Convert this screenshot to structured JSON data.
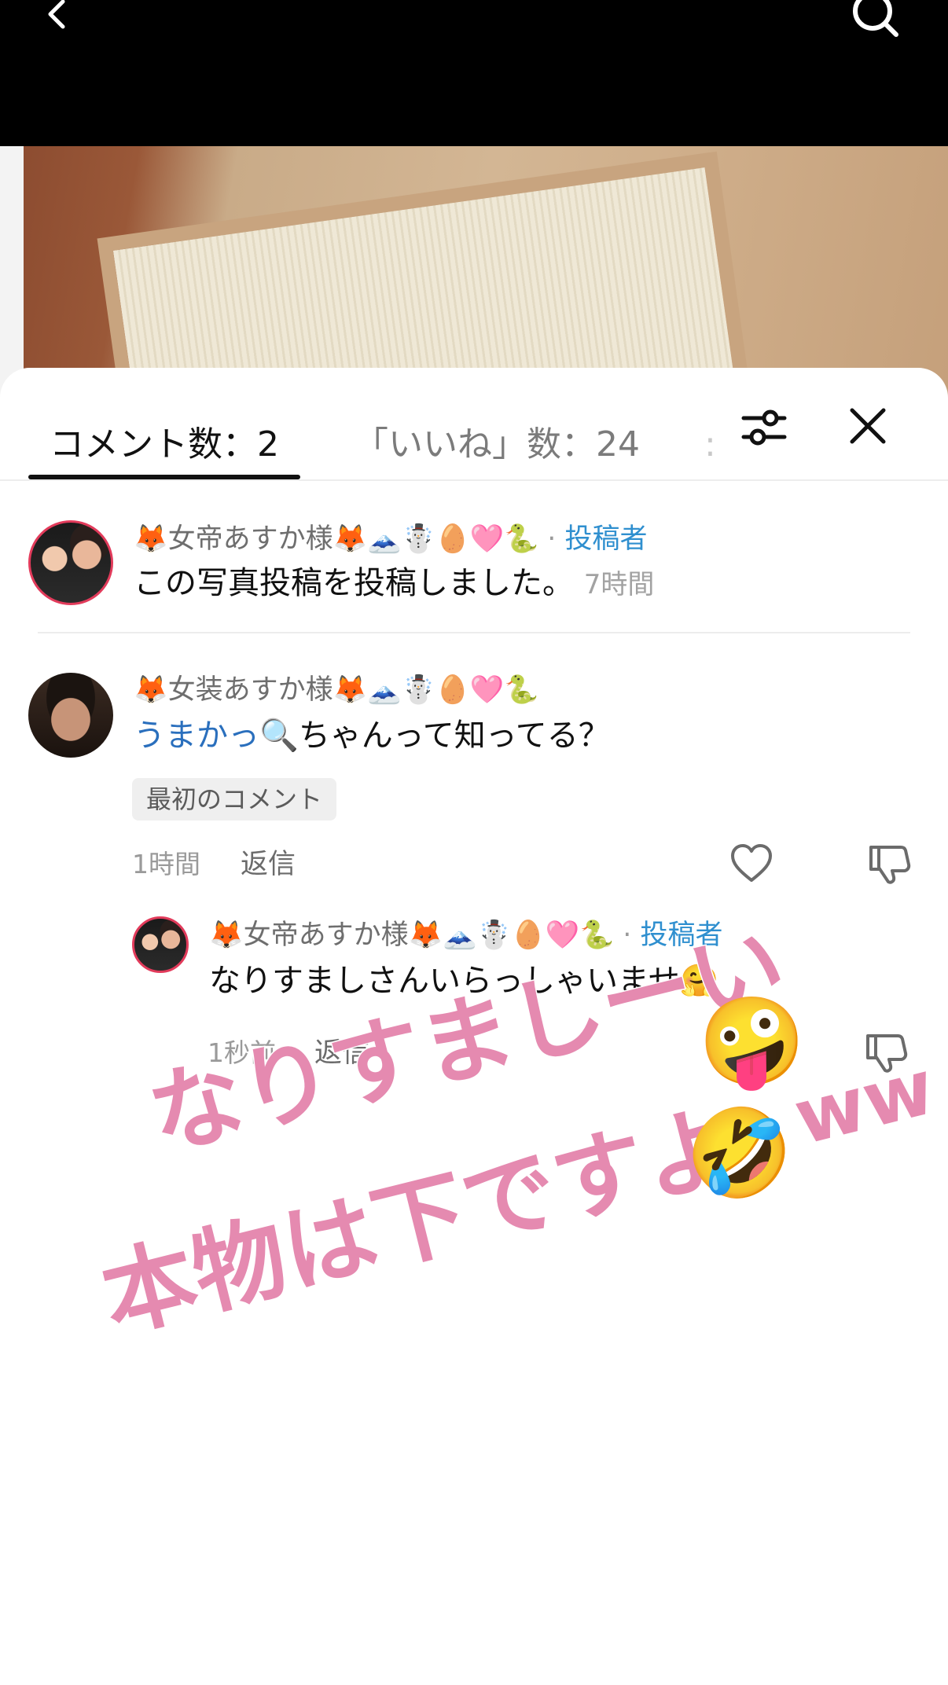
{
  "header": {
    "back_icon": "chevron-left-icon",
    "search_icon": "search-icon"
  },
  "tabs": {
    "comments_label": "コメント数：2",
    "likes_label": "「いいね」数：24",
    "more_label": ":",
    "filter_icon": "sliders-icon",
    "close_icon": "close-icon"
  },
  "comments": [
    {
      "author": "🦊女帝あすか様🦊🗻☃️🥚🩷🐍",
      "separator": " · ",
      "badge": "投稿者",
      "text": "この写真投稿を投稿しました。",
      "time": "7時間"
    },
    {
      "author": "🦊女装あすか様🦊🗻☃️🥚🩷🐍",
      "mention": "うまかっ🔍",
      "text": "ちゃんって知ってる？",
      "tag": "最初のコメント",
      "time": "1時間",
      "reply_label": "返信",
      "like_icon": "heart-icon",
      "dislike_icon": "thumbs-down-icon",
      "replies": [
        {
          "author": "🦊女帝あすか様🦊🗻☃️🥚🩷🐍",
          "separator": " · ",
          "badge": "投稿者",
          "text": "なりすましさんいらっしゃいませ🤗",
          "time": "1秒前",
          "reply_label": "返信",
          "dislike_icon": "thumbs-down-icon"
        }
      ]
    }
  ],
  "overlay": {
    "line1": "なりすましーい",
    "line1_emoji": "🤪",
    "line2": "本物は下ですよ",
    "line2_emoji": "🤣",
    "line2_suffix": "ww",
    "color": "#e58ab0"
  }
}
